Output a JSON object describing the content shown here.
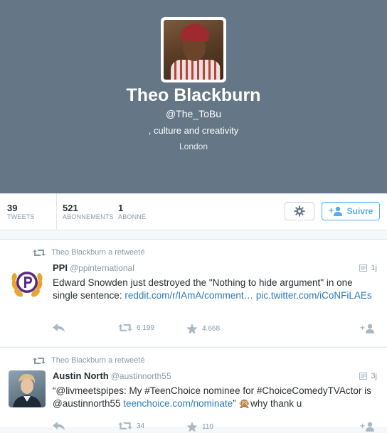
{
  "profile": {
    "name": "Theo Blackburn",
    "handle": "@The_ToBu",
    "bio": ", culture and creativity",
    "location": "London"
  },
  "stats": [
    {
      "value": "39",
      "label": "TWEETS"
    },
    {
      "value": "521",
      "label": "ABONNEMENTS"
    },
    {
      "value": "1",
      "label": "ABONNÉ"
    }
  ],
  "buttons": {
    "follow_label": "Suivre",
    "settings_icon": "gear-icon"
  },
  "colors": {
    "header_bg": "#657786",
    "accent": "#55acee",
    "link": "#2b7bb9"
  },
  "tweets": [
    {
      "retweet_label": "Theo Blackburn a retweeté",
      "author": "PPI",
      "handle": "@ppinternational",
      "time": "1j",
      "text_before": "Edward Snowden just destroyed the \"Nothing to hide argument\" in one single sentence: ",
      "link1": "reddit.com/r/IAmA/comment…",
      "link2": "pic.twitter.com/iCoNFiLAEs",
      "retweets": "6.199",
      "favorites": "4.668"
    },
    {
      "retweet_label": "Theo Blackburn a retweeté",
      "author": "Austin North",
      "handle": "@austinnorth55",
      "time": "3j",
      "text_before": "“@livmeetspipes: My #TeenChoice nominee for #ChoiceComedyTVActor is @austinnorth55 ",
      "link1": "teenchoice.com/nominate",
      "text_after": "” 🙊why thank u",
      "retweets": "34",
      "favorites": "110"
    }
  ]
}
